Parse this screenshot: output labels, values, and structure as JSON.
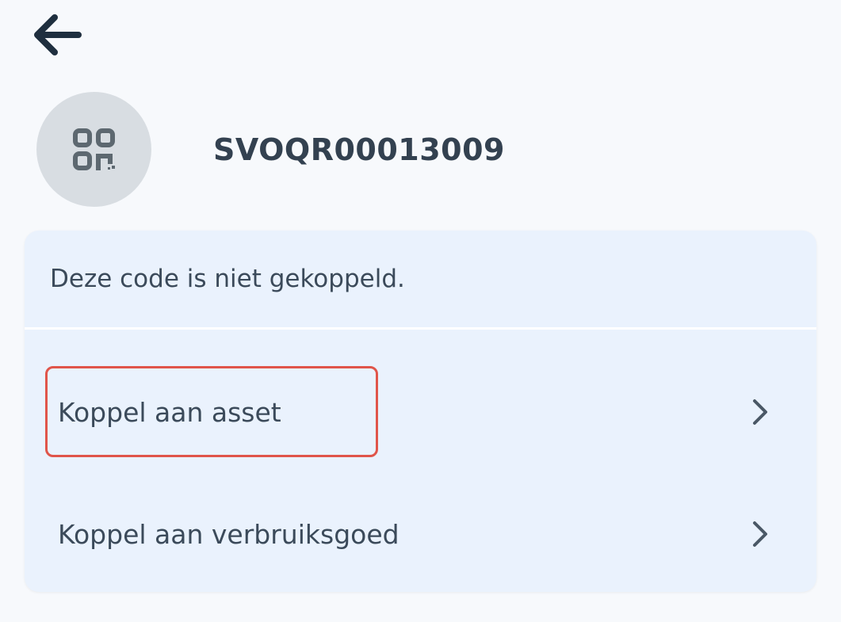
{
  "nav": {
    "back_icon": "arrow-left-icon"
  },
  "header": {
    "avatar_icon": "qr-code-icon",
    "code": "SVOQR00013009"
  },
  "card": {
    "message": "Deze code is niet gekoppeld.",
    "actions": [
      {
        "label": "Koppel aan asset",
        "icon": "chevron-right-icon"
      },
      {
        "label": "Koppel aan verbruiksgoed",
        "icon": "chevron-right-icon"
      }
    ]
  },
  "colors": {
    "background": "#f7f9fc",
    "card": "#eaf2fd",
    "avatar": "#d8dde2",
    "text": "#3b4a5a",
    "highlight": "#e0554a"
  }
}
